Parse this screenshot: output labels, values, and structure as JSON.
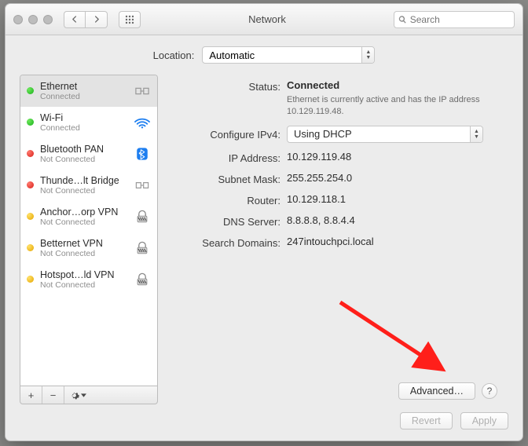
{
  "window": {
    "title": "Network"
  },
  "search": {
    "placeholder": "Search"
  },
  "location": {
    "label": "Location:",
    "value": "Automatic"
  },
  "services": [
    {
      "name": "Ethernet",
      "status": "Connected",
      "dot": "green",
      "icon": "ethernet"
    },
    {
      "name": "Wi-Fi",
      "status": "Connected",
      "dot": "green",
      "icon": "wifi"
    },
    {
      "name": "Bluetooth PAN",
      "status": "Not Connected",
      "dot": "red",
      "icon": "bluetooth"
    },
    {
      "name": "Thunde…lt Bridge",
      "status": "Not Connected",
      "dot": "red",
      "icon": "thunderbolt"
    },
    {
      "name": "Anchor…orp VPN",
      "status": "Not Connected",
      "dot": "yellow",
      "icon": "vpn"
    },
    {
      "name": "Betternet VPN",
      "status": "Not Connected",
      "dot": "yellow",
      "icon": "vpn"
    },
    {
      "name": "Hotspot…ld VPN",
      "status": "Not Connected",
      "dot": "yellow",
      "icon": "vpn"
    }
  ],
  "detail": {
    "status_label": "Status:",
    "status_value": "Connected",
    "status_note": "Ethernet is currently active and has the IP address 10.129.119.48.",
    "config_label": "Configure IPv4:",
    "config_value": "Using DHCP",
    "ip_label": "IP Address:",
    "ip_value": "10.129.119.48",
    "subnet_label": "Subnet Mask:",
    "subnet_value": "255.255.254.0",
    "router_label": "Router:",
    "router_value": "10.129.118.1",
    "dns_label": "DNS Server:",
    "dns_value": "8.8.8.8, 8.8.4.4",
    "search_label": "Search Domains:",
    "search_value": "247intouchpci.local"
  },
  "buttons": {
    "advanced": "Advanced…",
    "help": "?",
    "revert": "Revert",
    "apply": "Apply",
    "add": "+",
    "remove": "−",
    "gear": "⚙"
  }
}
